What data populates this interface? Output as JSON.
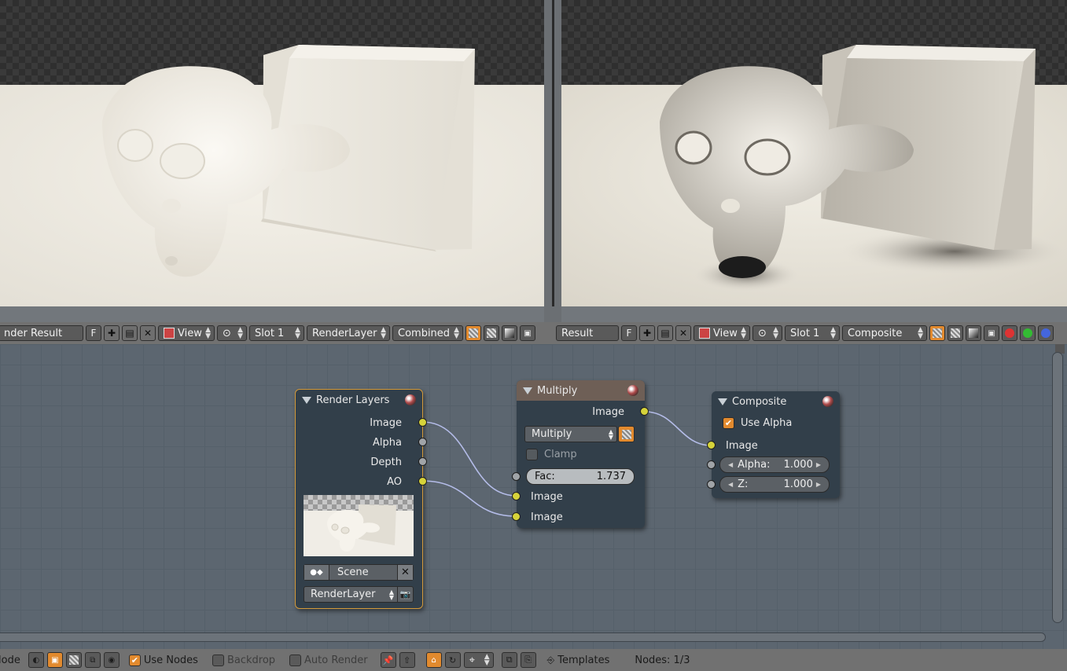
{
  "viewer_left": {
    "image_name": "nder Result",
    "f_label": "F",
    "view_label": "View",
    "slot_label": "Slot 1",
    "layer_label": "RenderLayer",
    "pass_label": "Combined"
  },
  "viewer_right": {
    "image_name": "Result",
    "f_label": "F",
    "view_label": "View",
    "slot_label": "Slot 1",
    "pass_label": "Composite"
  },
  "nodes": {
    "render_layers": {
      "title": "Render Layers",
      "outputs": [
        "Image",
        "Alpha",
        "Depth",
        "AO"
      ],
      "scene_label": "Scene",
      "layer_label": "RenderLayer"
    },
    "multiply": {
      "title": "Multiply",
      "output_label": "Image",
      "blend_mode": "Multiply",
      "clamp_label": "Clamp",
      "fac_label": "Fac:",
      "fac_value": "1.737",
      "inputs": [
        "Image",
        "Image"
      ]
    },
    "composite": {
      "title": "Composite",
      "use_alpha_label": "Use Alpha",
      "input_label": "Image",
      "alpha_label": "Alpha:",
      "alpha_value": "1.000",
      "z_label": "Z:",
      "z_value": "1.000"
    }
  },
  "bottom_bar": {
    "mode_label": "lode",
    "use_nodes_label": "Use Nodes",
    "backdrop_label": "Backdrop",
    "auto_render_label": "Auto Render",
    "templates_label": "Templates",
    "nodes_count": "Nodes: 1/3"
  },
  "colors": {
    "accent": "#e28a2e",
    "node_bg": "#323f4a",
    "editor_bg": "#5c6670",
    "socket_yellow": "#d6d33a",
    "socket_gray": "#a0a4a8",
    "wire": "#b4bce8"
  }
}
